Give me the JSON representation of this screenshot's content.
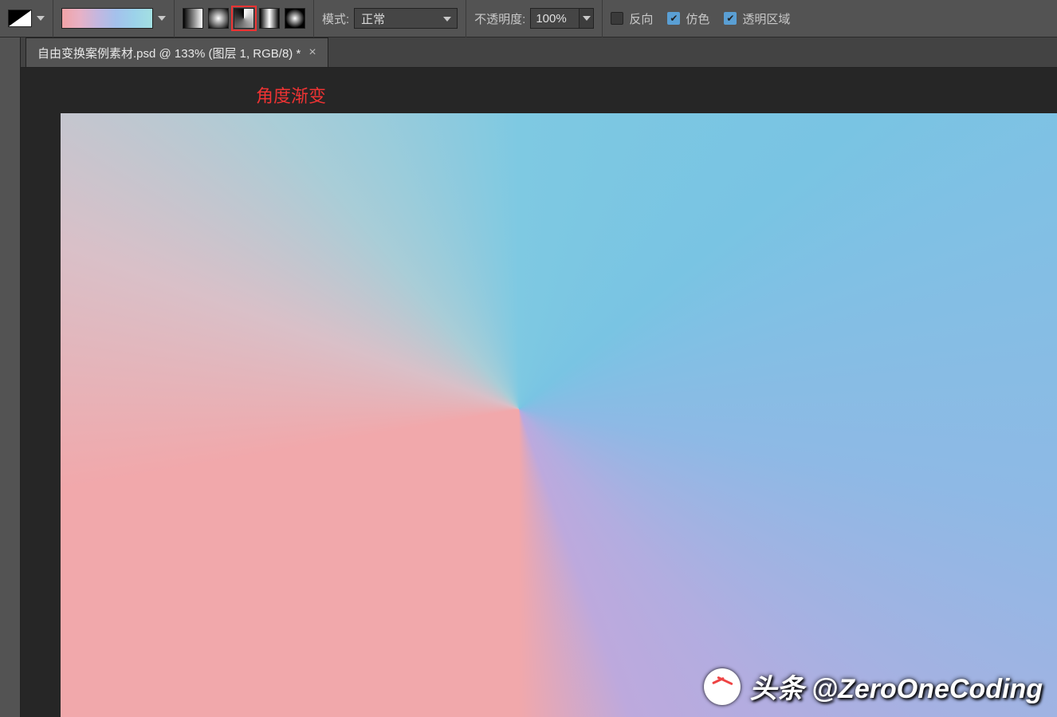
{
  "options": {
    "mode_label": "模式:",
    "mode_value": "正常",
    "opacity_label": "不透明度:",
    "opacity_value": "100%",
    "reverse_label": "反向",
    "dither_label": "仿色",
    "transparency_label": "透明区域",
    "reverse_checked": false,
    "dither_checked": true,
    "transparency_checked": true,
    "gradient_types": [
      "linear",
      "radial",
      "angle",
      "reflect",
      "diamond"
    ],
    "gradient_selected": "angle"
  },
  "tab": {
    "title": "自由变换案例素材.psd @ 133% (图层 1, RGB/8) *"
  },
  "annotation": {
    "text": "角度渐变"
  },
  "watermark": {
    "text": "头条 @ZeroOneCoding"
  }
}
